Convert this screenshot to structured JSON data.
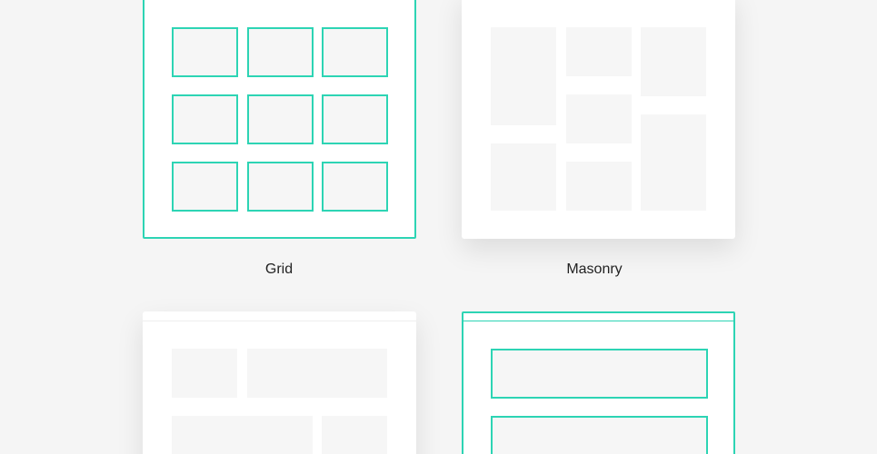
{
  "layout_options": [
    {
      "label": "Grid",
      "state": "selected"
    },
    {
      "label": "Masonry",
      "state": "default"
    }
  ],
  "colors": {
    "accent": "#2dd4b4",
    "page_background": "#f5f5f5",
    "card_background": "#ffffff",
    "placeholder": "#f6f6f6"
  }
}
